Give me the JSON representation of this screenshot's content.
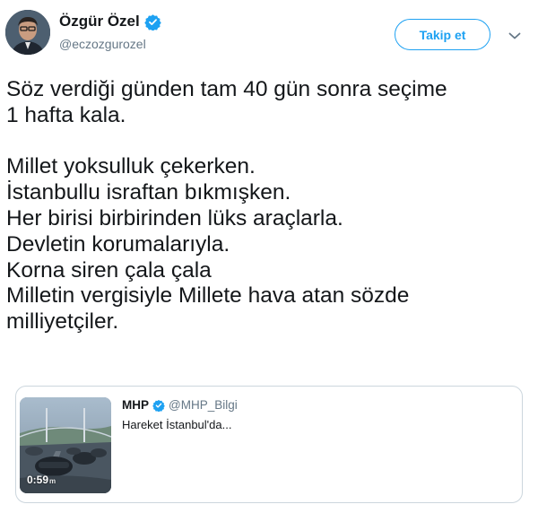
{
  "author": {
    "display_name": "Özgür Özel",
    "handle": "@eczozgurozel",
    "verified": true
  },
  "actions": {
    "follow_label": "Takip et",
    "menu_icon": "chevron-down-icon"
  },
  "tweet": {
    "lines": [
      "Söz verdiği günden tam 40 gün sonra seçime",
      "1 hafta kala.",
      "",
      "Millet yoksulluk çekerken.",
      "İstanbullu israftan bıkmışken.",
      "Her birisi birbirinden lüks araçlarla.",
      "Devletin korumalarıyla.",
      "Korna siren çala çala",
      "Milletin vergisiyle Millete hava atan sözde",
      "milliyetçiler."
    ]
  },
  "quoted": {
    "name": "MHP",
    "handle": "@MHP_Bilgi",
    "verified": true,
    "text": "Hareket İstanbul'da...",
    "video_duration": "0:59",
    "video_views_suffix": "m"
  },
  "colors": {
    "accent": "#1da1f2",
    "text": "#14171a",
    "secondary_text": "#657786",
    "border": "#ccd6dd"
  }
}
